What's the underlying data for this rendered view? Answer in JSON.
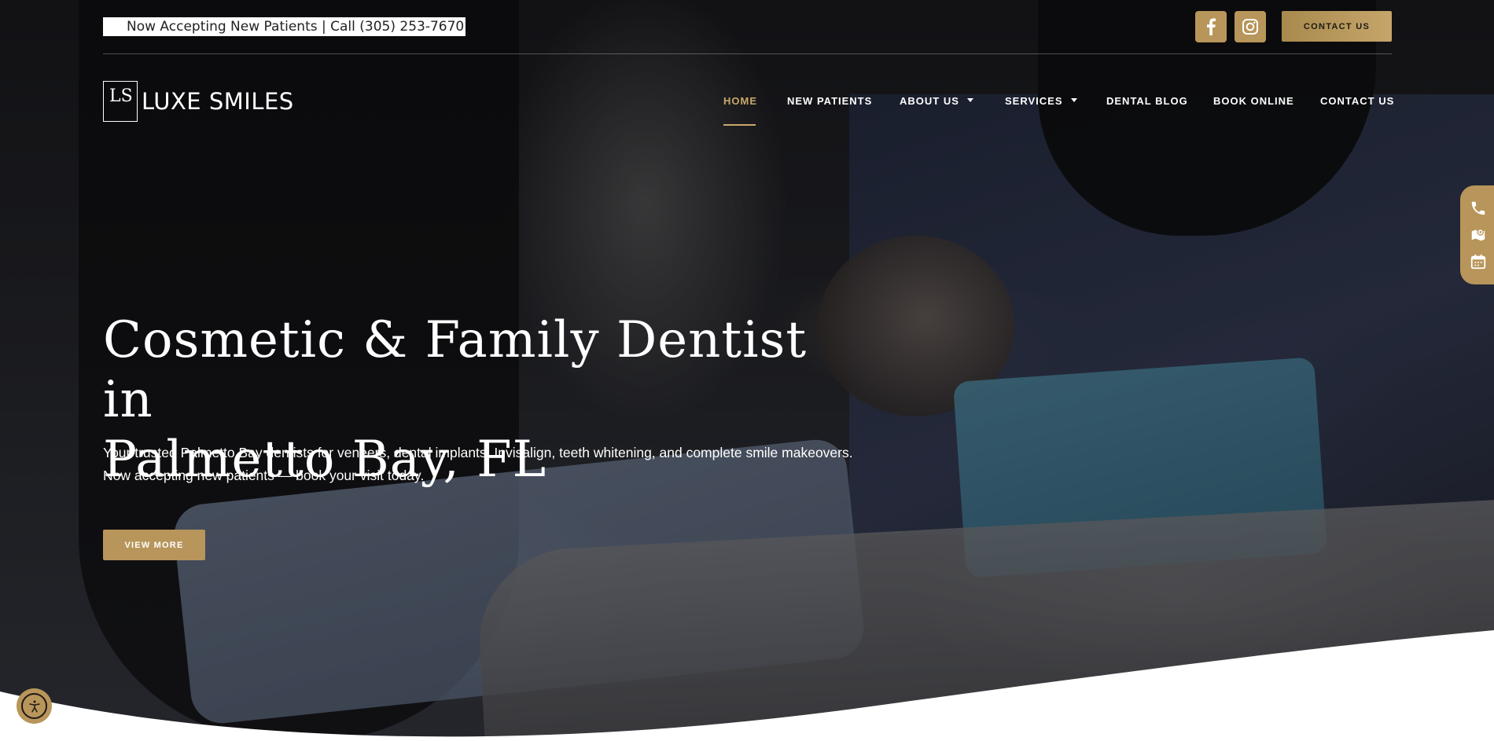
{
  "topbar": {
    "announcement": "Now Accepting New Patients | Call (305) 253-7670",
    "contact_button": "CONTACT US",
    "social_icons": [
      "facebook-icon",
      "instagram-icon"
    ]
  },
  "brand": {
    "logo_mark": "LS",
    "name": "LUXE SMILES"
  },
  "nav": {
    "items": [
      {
        "label": "HOME",
        "active": true
      },
      {
        "label": "NEW PATIENTS"
      },
      {
        "label": "ABOUT US",
        "dropdown": true
      },
      {
        "label": "SERVICES",
        "dropdown": true
      },
      {
        "label": "DENTAL BLOG"
      },
      {
        "label": "BOOK ONLINE"
      },
      {
        "label": "CONTACT US"
      }
    ]
  },
  "hero": {
    "title_line1": "Cosmetic & Family Dentist in",
    "title_line2": "Palmetto Bay, FL",
    "subtitle": "Your trusted Palmetto Bay dentists for veneers, dental implants, Invisalign, teeth whitening, and complete smile makeovers. Now accepting new patients — book your visit today.",
    "cta_label": "VIEW MORE"
  },
  "side_actions": [
    "phone-icon",
    "map-icon",
    "calendar-icon"
  ],
  "colors": {
    "accent_gold": "#b8955a",
    "active_nav": "#c9a96b",
    "text_light": "#ffffff"
  }
}
